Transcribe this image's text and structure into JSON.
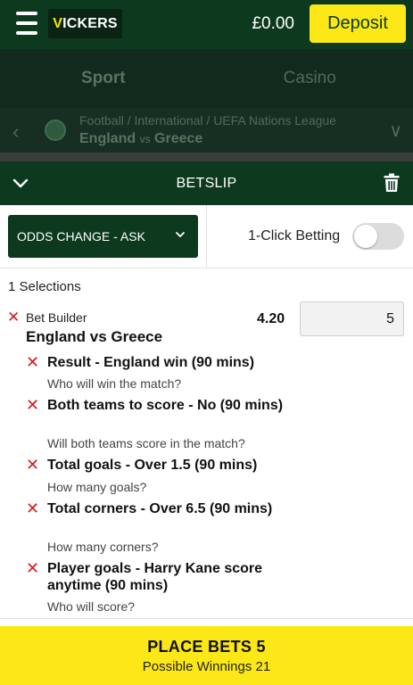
{
  "header": {
    "logo_text": "VICKERS",
    "logo_accent": "V",
    "logo_rest": "ICKERS",
    "balance": "£0.00",
    "deposit_label": "Deposit",
    "accent_color": "#fbe816",
    "brand_color": "#0d3a1e"
  },
  "nav": {
    "tabs": [
      {
        "label": "Sport",
        "active": true
      },
      {
        "label": "Casino",
        "active": false
      }
    ]
  },
  "match": {
    "breadcrumb": "Football / International / UEFA Nations League",
    "home": "England",
    "vs": "vs",
    "away": "Greece"
  },
  "betslip": {
    "title": "BETSLIP",
    "odds_change_option": "ODDS CHANGE - ASK",
    "one_click_label": "1-Click Betting",
    "one_click_enabled": false,
    "selections_count_label": "1 Selections",
    "bet_builder": {
      "label": "Bet Builder",
      "match": "England vs Greece",
      "odds": "4.20",
      "stake": "5",
      "legs": [
        {
          "title": "Result - England win (90 mins)",
          "question": "Who will win the match?"
        },
        {
          "title": "Both teams to score - No (90 mins)",
          "question": "Will both teams score in the match?"
        },
        {
          "title": "Total goals - Over 1.5 (90 mins)",
          "question": "How many goals?"
        },
        {
          "title": "Total corners - Over 6.5 (90 mins)",
          "question": "How many corners?"
        },
        {
          "title": "Player goals - Harry Kane score anytime (90 mins)",
          "question": "Who will score?"
        }
      ]
    },
    "place_bets_label": "PLACE BETS 5",
    "possible_winnings_label": "Possible Winnings 21"
  }
}
